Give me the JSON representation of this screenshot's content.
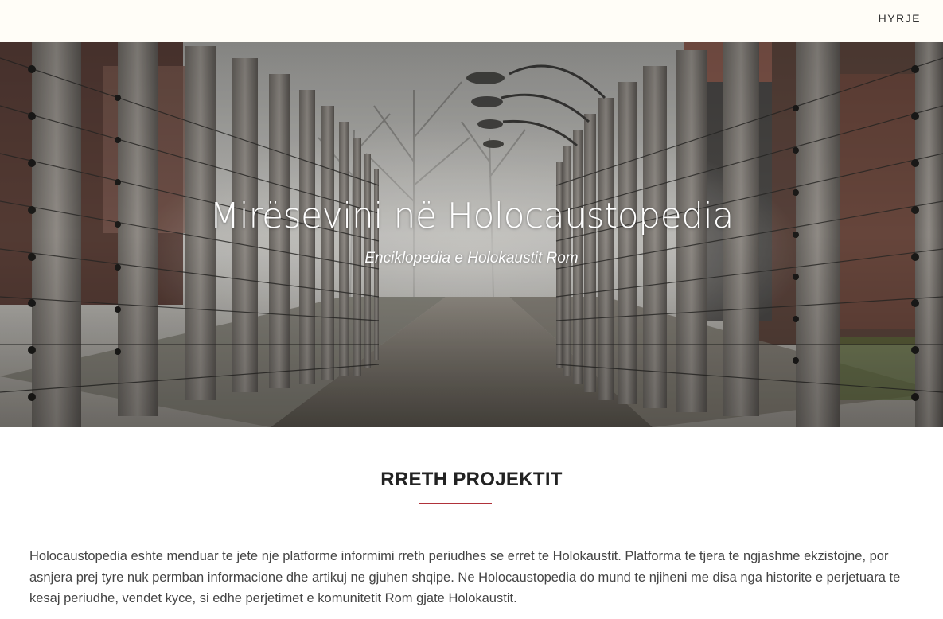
{
  "nav": {
    "links": [
      {
        "label": "HYRJE"
      }
    ]
  },
  "hero": {
    "title": "Mirësevini në Holocaustopedia",
    "subtitle": "Enciklopedia e Holokaustit Rom"
  },
  "about": {
    "heading": "RRETH PROJEKTIT",
    "paragraph": "Holocaustopedia eshte menduar te jete nje platforme informimi rreth periudhes se erret te Holokaustit. Platforma te tjera te ngjashme ekzistojne, por asnjera prej tyre nuk permban informacione dhe artikuj ne gjuhen shqipe. Ne Holocaustopedia do mund te njiheni me disa nga historite e perjetuara te kesaj periudhe, vendet kyce, si edhe perjetimet e komunitetit Rom gjate Holokaustit."
  },
  "colors": {
    "accent": "#b0323a",
    "topbar_bg": "#fffdf7",
    "text": "#444444"
  }
}
